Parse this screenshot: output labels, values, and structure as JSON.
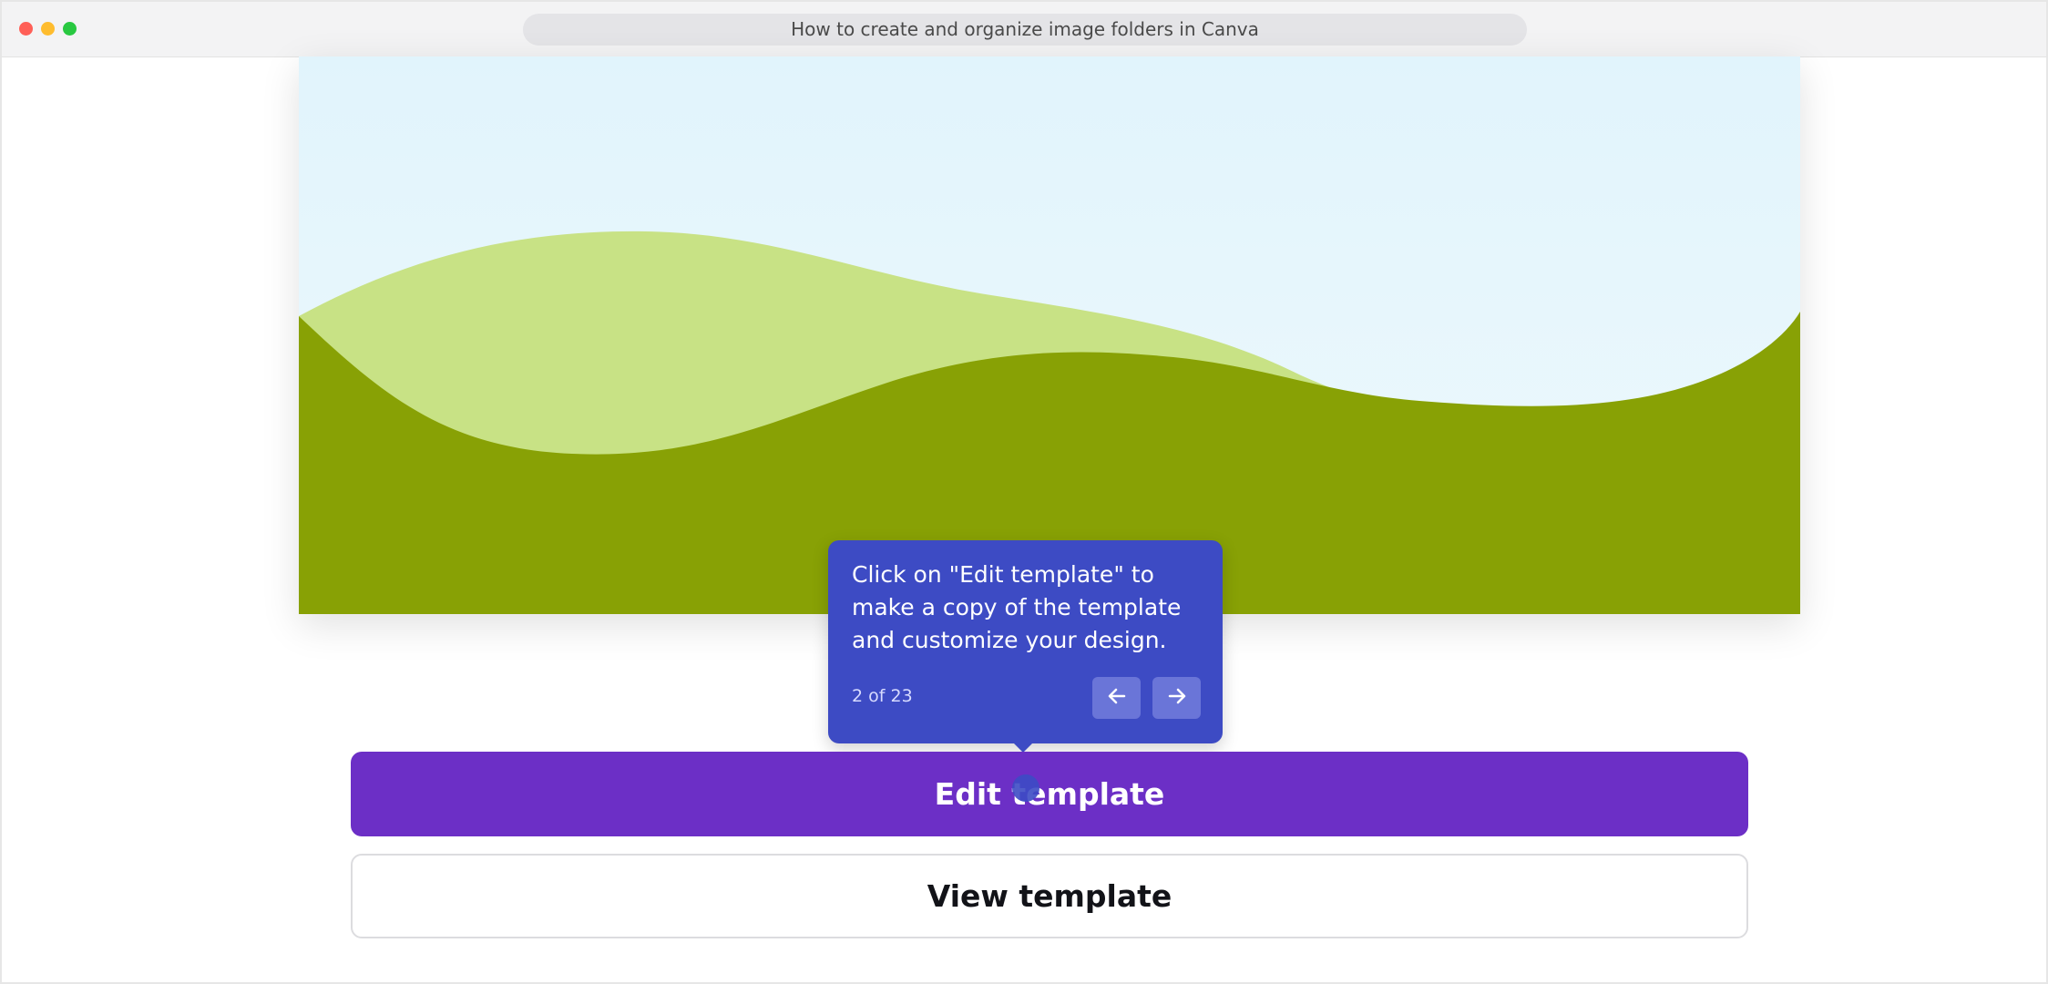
{
  "window": {
    "title": "How to create and organize image folders in Canva"
  },
  "tooltip": {
    "text": "Click on \"Edit template\" to make a copy of the template and customize your design.",
    "counter": "2 of 23",
    "prev_icon": "arrow-left-icon",
    "next_icon": "arrow-right-icon"
  },
  "actions": {
    "edit_label": "Edit template",
    "view_label": "View template"
  },
  "colors": {
    "tooltip_bg": "#3d4bc4",
    "edit_button_bg": "#6c2fc6",
    "hill_dark": "#88a105",
    "hill_light": "#c8e285",
    "sky": "#e6f6fd"
  }
}
